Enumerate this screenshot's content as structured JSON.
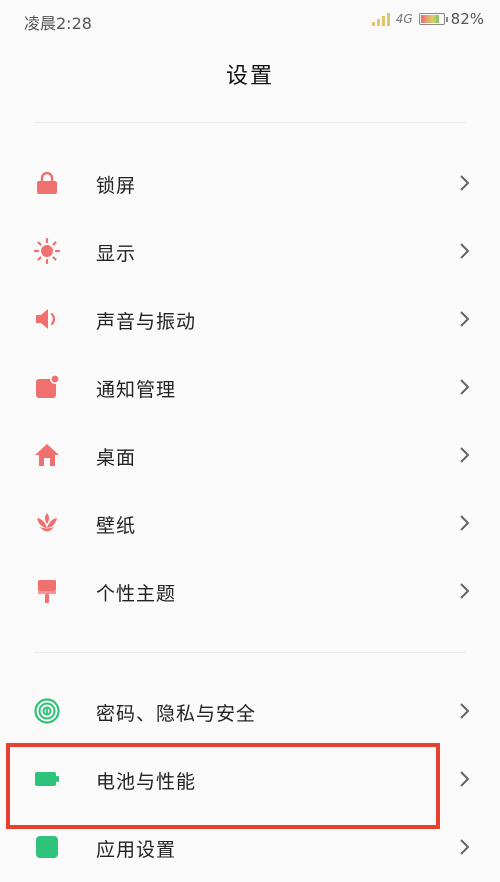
{
  "status_bar": {
    "time": "凌晨2:28",
    "network": "4G",
    "battery_percent": "82%",
    "battery_level": 0.82
  },
  "header": {
    "title": "设置"
  },
  "group1": [
    {
      "label": "锁屏",
      "icon": "lock-icon",
      "color": "#f07070"
    },
    {
      "label": "显示",
      "icon": "sun-icon",
      "color": "#f07070"
    },
    {
      "label": "声音与振动",
      "icon": "speaker-icon",
      "color": "#f07070"
    },
    {
      "label": "通知管理",
      "icon": "notification-icon",
      "color": "#f07070"
    },
    {
      "label": "桌面",
      "icon": "home-icon",
      "color": "#f07070"
    },
    {
      "label": "壁纸",
      "icon": "flower-icon",
      "color": "#f07070"
    },
    {
      "label": "个性主题",
      "icon": "brush-icon",
      "color": "#f07070"
    }
  ],
  "group2": [
    {
      "label": "密码、隐私与安全",
      "icon": "fingerprint-icon",
      "color": "#2fc27a"
    },
    {
      "label": "电池与性能",
      "icon": "battery-icon",
      "color": "#2fc27a"
    },
    {
      "label": "应用设置",
      "icon": "apps-icon",
      "color": "#2fc27a"
    }
  ],
  "colors": {
    "accent_red": "#f07070",
    "accent_green": "#2fc27a",
    "highlight": "#e8402f"
  }
}
